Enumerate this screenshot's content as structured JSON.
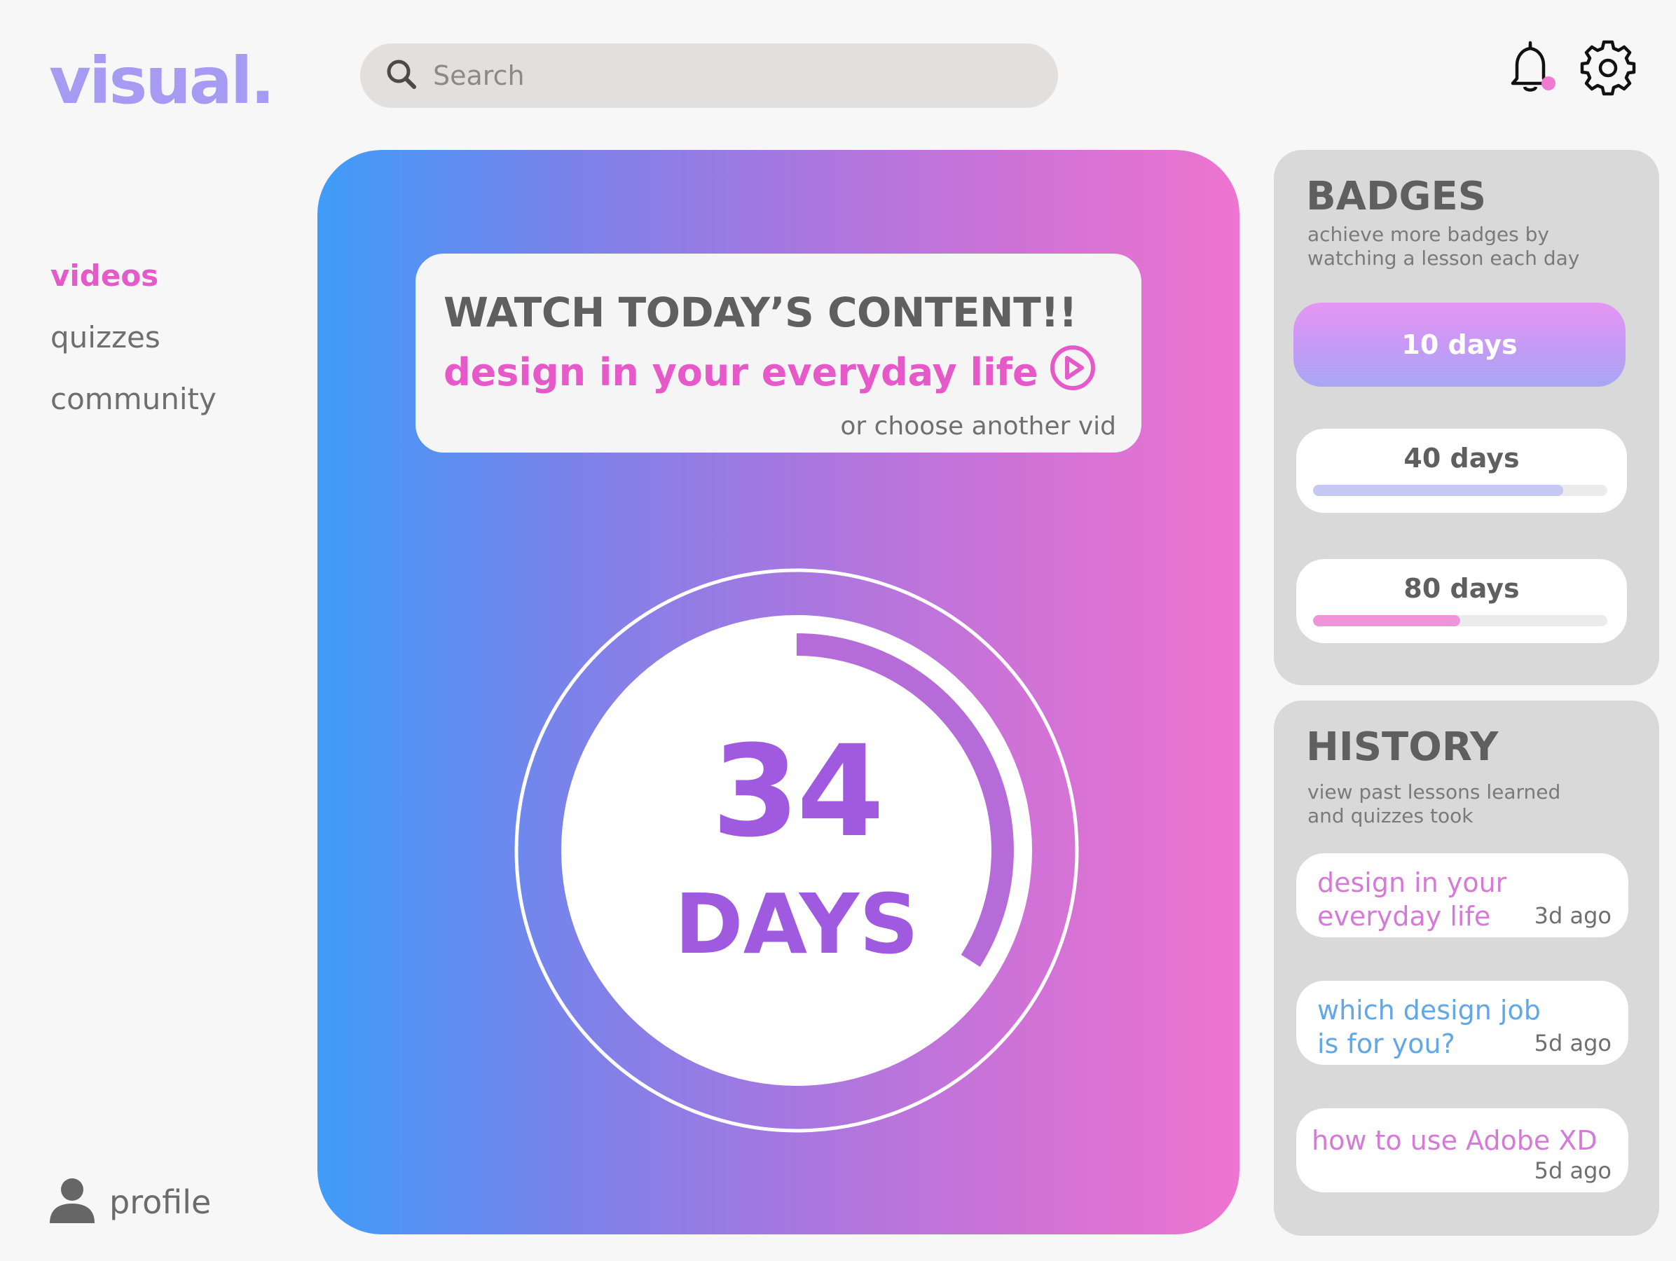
{
  "app": {
    "logo": "visual."
  },
  "search": {
    "placeholder": "Search",
    "value": ""
  },
  "header": {
    "notification_icon": "bell-icon",
    "settings_icon": "gear-icon"
  },
  "nav": {
    "items": [
      {
        "label": "videos",
        "active": true
      },
      {
        "label": "quizzes",
        "active": false
      },
      {
        "label": "community",
        "active": false
      }
    ]
  },
  "profile": {
    "label": "profile",
    "icon": "person-icon"
  },
  "today": {
    "title": "WATCH TODAY’S CONTENT!!",
    "video_title": "design in your everyday life",
    "play_icon": "play-circle-icon",
    "alternate_link": "or choose another vid"
  },
  "streak": {
    "value": "34",
    "unit": "DAYS",
    "progress": 0.34
  },
  "badges": {
    "title": "BADGES",
    "subtitle": "achieve more badges by watching a lesson each day",
    "items": [
      {
        "label": "10 days",
        "achieved": true
      },
      {
        "label": "40 days",
        "progress": 0.85,
        "color": "#c5c8f3"
      },
      {
        "label": "80 days",
        "progress": 0.5,
        "color": "#ef94d8"
      }
    ]
  },
  "history": {
    "title": "HISTORY",
    "subtitle": "view past lessons learned and quizzes took",
    "items": [
      {
        "title": "design in your everyday life",
        "time": "3d ago",
        "color": "#d57ad6"
      },
      {
        "title": "which design job is for you?",
        "time": "5d ago",
        "color": "#62a7e6"
      },
      {
        "title": "how to use Adobe XD",
        "time": "5d ago",
        "color": "#d57ad6"
      }
    ]
  },
  "colors": {
    "accent": "#e659c9",
    "logo": "#a79af2",
    "ring_text": "#a05ae0"
  }
}
